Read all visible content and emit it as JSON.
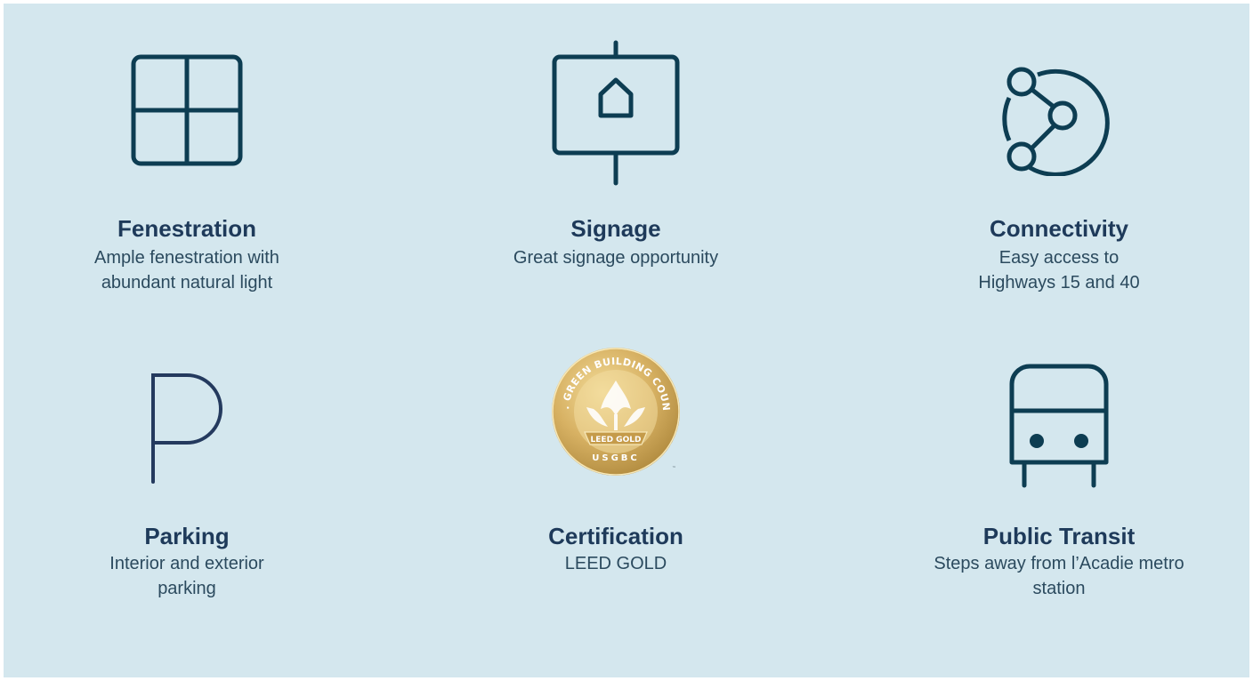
{
  "features": [
    {
      "title": "Fenestration",
      "desc_line1": "Ample fenestration with",
      "desc_line2": "abundant natural light",
      "icon": "window-grid-icon"
    },
    {
      "title": "Signage",
      "desc_line1": "Great signage opportunity",
      "desc_line2": "",
      "icon": "signboard-icon"
    },
    {
      "title": "Connectivity",
      "desc_line1": "Easy access to",
      "desc_line2": "Highways 15 and 40",
      "icon": "network-connectivity-icon"
    },
    {
      "title": "Parking",
      "desc_line1": "Interior and exterior",
      "desc_line2": "parking",
      "icon": "parking-p-icon"
    },
    {
      "title": "Certification",
      "desc_line1": "LEED GOLD",
      "desc_line2": "",
      "icon": "leed-gold-seal-icon",
      "seal_text_top": "U.S. GREEN BUILDING COUNCIL",
      "seal_text_banner": "LEED GOLD",
      "seal_text_bottom": "USGBC",
      "seal_tm": "™"
    },
    {
      "title": "Public Transit",
      "desc_line1": "Steps away from l’Acadie metro",
      "desc_line2": "station",
      "icon": "bus-front-icon"
    }
  ],
  "colors": {
    "background": "#d4e7ee",
    "icon_stroke": "#0d3d52",
    "title": "#1e3a5a",
    "text": "#2b4a5e",
    "gold": "#d2ad5b"
  }
}
